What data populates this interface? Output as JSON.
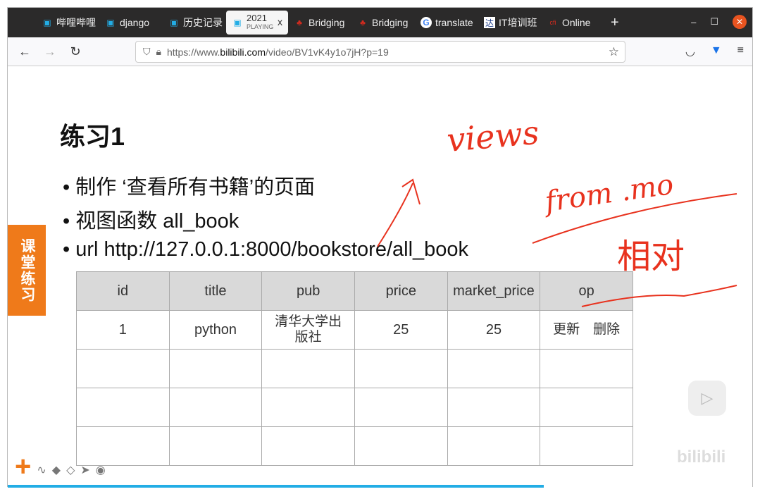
{
  "browser": {
    "tabs": [
      {
        "label": "哔哩哔哩",
        "icon": "bilibili-icon"
      },
      {
        "label": "django",
        "icon": "bilibili-icon"
      },
      {
        "label": "历史记录",
        "icon": "bilibili-icon"
      },
      {
        "label": "2021",
        "sublabel": "PLAYING",
        "icon": "bilibili-icon",
        "active": true
      },
      {
        "label": "Bridging",
        "icon": "maple-leaf-icon"
      },
      {
        "label": "Bridging",
        "icon": "maple-leaf-icon"
      },
      {
        "label": "translate",
        "icon": "google-icon"
      },
      {
        "label": "IT培训班",
        "icon": "da-icon"
      },
      {
        "label": "Online",
        "icon": "cfi-icon"
      }
    ],
    "url_prefix": "https://www.",
    "url_domain": "bilibili.com",
    "url_path": "/video/BV1vK4y1o7jH?p=19",
    "new_tab": "+",
    "close_tab": "x"
  },
  "slide": {
    "side_tag": "课堂练习",
    "title": "练习1",
    "bullets": [
      "• 制作 ‘查看所有书籍’的页面",
      "• 视图函数 all_book",
      "• url http://127.0.0.1:8000/bookstore/all_book"
    ],
    "table": {
      "headers": [
        "id",
        "title",
        "pub",
        "price",
        "market_price",
        "op"
      ],
      "rows": [
        [
          "1",
          "python",
          "清华大学出版社",
          "25",
          "25",
          "更新　删除"
        ],
        [
          "",
          "",
          "",
          "",
          "",
          ""
        ],
        [
          "",
          "",
          "",
          "",
          "",
          ""
        ],
        [
          "",
          "",
          "",
          "",
          "",
          ""
        ]
      ]
    },
    "handwriting": [
      "views",
      "from .mo",
      "相对"
    ],
    "annotation_color": "#e8321e"
  },
  "player": {
    "progress_percent": 72,
    "brand": "bilibili",
    "accent": "#23ade5"
  }
}
